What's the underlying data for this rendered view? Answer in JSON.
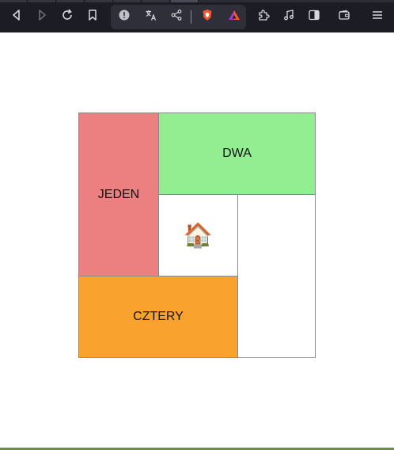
{
  "browser": {
    "toolbar_icons": [
      "back-icon",
      "forward-icon",
      "reload-icon",
      "bookmark-icon",
      "info-icon",
      "translate-icon",
      "share-icon",
      "brave-shields-icon",
      "brave-rewards-icon",
      "extensions-icon",
      "media-icon",
      "sidebar-icon",
      "wallet-icon",
      "menu-icon"
    ],
    "colors": {
      "chrome_bg": "#1c1d24",
      "urlbar_bg": "#2e2f38",
      "brave_orange": "#fb542b"
    }
  },
  "grid": {
    "cells": {
      "jeden": {
        "label": "JEDEN",
        "color": "#ec8080"
      },
      "dwa": {
        "label": "DWA",
        "color": "#93ee92"
      },
      "center": {
        "label": "🏠",
        "icon": "house-icon",
        "color": "#ffffff"
      },
      "right": {
        "label": "",
        "color": "#ffffff"
      },
      "cztery": {
        "label": "CZTERY",
        "color": "#faa22e"
      }
    }
  }
}
